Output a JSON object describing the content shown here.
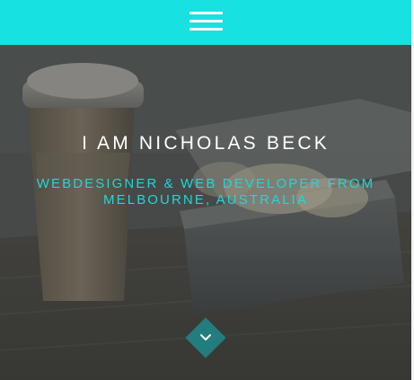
{
  "navbar": {
    "menu_icon": "hamburger-menu-icon",
    "background_color": "#17e1e1"
  },
  "hero": {
    "title": "I AM NICHOLAS BECK",
    "subtitle": "WEBDESIGNER & WEB DEVELOPER FROM MELBOURNE, AUSTRALIA",
    "accent_color": "#21d6d9",
    "scroll_icon": "chevron-down-icon"
  }
}
